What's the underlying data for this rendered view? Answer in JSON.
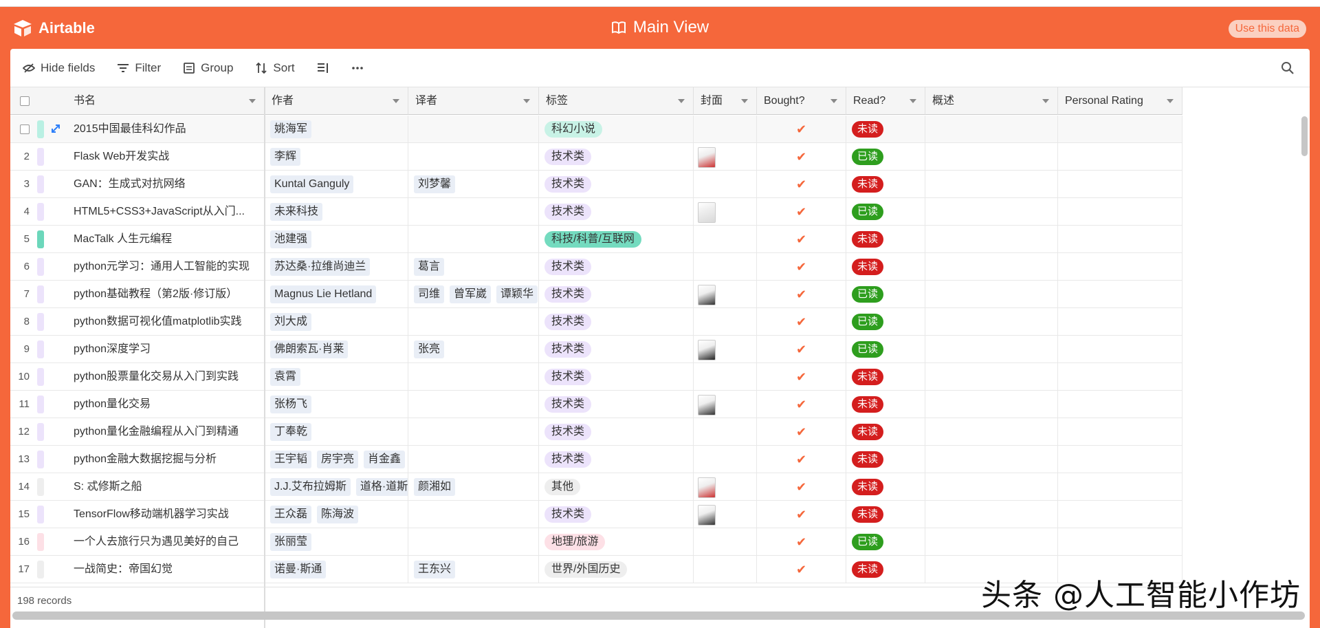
{
  "header": {
    "brand": "Airtable",
    "view_title": "Main View",
    "use_data": "Use this data"
  },
  "toolbar": {
    "hide_fields": "Hide fields",
    "filter": "Filter",
    "group": "Group",
    "sort": "Sort"
  },
  "columns": {
    "title": "书名",
    "author": "作者",
    "translator": "译者",
    "tags": "标签",
    "cover": "封面",
    "bought": "Bought?",
    "read": "Read?",
    "summary": "概述",
    "rating": "Personal Rating"
  },
  "colors": {
    "brand": "#f5673b",
    "read": "#2e9e1e",
    "unread": "#d41e1e"
  },
  "rows": [
    {
      "num": "",
      "bar": "#b9f0e3",
      "title": "2015中国最佳科幻作品",
      "authors": [
        "姚海军"
      ],
      "translators": [],
      "tag": "科幻小说",
      "tag_bg": "#c8f2e6",
      "cover": false,
      "bought": "✔",
      "read": "未读",
      "read_color": "#d41e1e"
    },
    {
      "num": "2",
      "bar": "#ece3fb",
      "title": "Flask Web开发实战",
      "authors": [
        "李辉"
      ],
      "translators": [],
      "tag": "技术类",
      "tag_bg": "#ece3fb",
      "cover": true,
      "bought": "✔",
      "read": "已读",
      "read_color": "#2e9e1e"
    },
    {
      "num": "3",
      "bar": "#ece3fb",
      "title": "GAN：生成式对抗网络",
      "authors": [
        "Kuntal Ganguly"
      ],
      "translators": [
        "刘梦馨"
      ],
      "tag": "技术类",
      "tag_bg": "#ece3fb",
      "cover": false,
      "bought": "✔",
      "read": "未读",
      "read_color": "#d41e1e"
    },
    {
      "num": "4",
      "bar": "#ece3fb",
      "title": "HTML5+CSS3+JavaScript从入门...",
      "authors": [
        "未来科技"
      ],
      "translators": [],
      "tag": "技术类",
      "tag_bg": "#ece3fb",
      "cover": true,
      "bought": "✔",
      "read": "已读",
      "read_color": "#2e9e1e"
    },
    {
      "num": "5",
      "bar": "#6cd7bb",
      "title": "MacTalk 人生元编程",
      "authors": [
        "池建强"
      ],
      "translators": [],
      "tag": "科技/科普/互联网",
      "tag_bg": "#74dbbf",
      "cover": false,
      "bought": "✔",
      "read": "未读",
      "read_color": "#d41e1e"
    },
    {
      "num": "6",
      "bar": "#ece3fb",
      "title": "python元学习：通用人工智能的实现",
      "authors": [
        "苏达桑·拉维尚迪兰"
      ],
      "translators": [
        "葛言"
      ],
      "tag": "技术类",
      "tag_bg": "#ece3fb",
      "cover": false,
      "bought": "✔",
      "read": "未读",
      "read_color": "#d41e1e"
    },
    {
      "num": "7",
      "bar": "#ece3fb",
      "title": "python基础教程（第2版·修订版）",
      "authors": [
        "Magnus Lie Hetland"
      ],
      "translators": [
        "司维",
        "曾军崴",
        "谭颖华"
      ],
      "tag": "技术类",
      "tag_bg": "#ece3fb",
      "cover": true,
      "bought": "✔",
      "read": "已读",
      "read_color": "#2e9e1e"
    },
    {
      "num": "8",
      "bar": "#ece3fb",
      "title": "python数据可视化值matplotlib实践",
      "authors": [
        "刘大成"
      ],
      "translators": [],
      "tag": "技术类",
      "tag_bg": "#ece3fb",
      "cover": false,
      "bought": "✔",
      "read": "已读",
      "read_color": "#2e9e1e"
    },
    {
      "num": "9",
      "bar": "#ece3fb",
      "title": "python深度学习",
      "authors": [
        "佛朗索瓦·肖莱"
      ],
      "translators": [
        "张亮"
      ],
      "tag": "技术类",
      "tag_bg": "#ece3fb",
      "cover": true,
      "bought": "✔",
      "read": "已读",
      "read_color": "#2e9e1e"
    },
    {
      "num": "10",
      "bar": "#ece3fb",
      "title": "python股票量化交易从入门到实践",
      "authors": [
        "袁霄"
      ],
      "translators": [],
      "tag": "技术类",
      "tag_bg": "#ece3fb",
      "cover": false,
      "bought": "✔",
      "read": "未读",
      "read_color": "#d41e1e"
    },
    {
      "num": "11",
      "bar": "#ece3fb",
      "title": "python量化交易",
      "authors": [
        "张杨飞"
      ],
      "translators": [],
      "tag": "技术类",
      "tag_bg": "#ece3fb",
      "cover": true,
      "bought": "✔",
      "read": "未读",
      "read_color": "#d41e1e"
    },
    {
      "num": "12",
      "bar": "#ece3fb",
      "title": "python量化金融编程从入门到精通",
      "authors": [
        "丁奉乾"
      ],
      "translators": [],
      "tag": "技术类",
      "tag_bg": "#ece3fb",
      "cover": false,
      "bought": "✔",
      "read": "未读",
      "read_color": "#d41e1e"
    },
    {
      "num": "13",
      "bar": "#ece3fb",
      "title": "python金融大数据挖掘与分析",
      "authors": [
        "王宇韬",
        "房宇亮",
        "肖金鑫"
      ],
      "translators": [],
      "tag": "技术类",
      "tag_bg": "#ece3fb",
      "cover": false,
      "bought": "✔",
      "read": "未读",
      "read_color": "#d41e1e"
    },
    {
      "num": "14",
      "bar": "#eeeeee",
      "title": "S: 忒修斯之船",
      "authors": [
        "J.J.艾布拉姆斯",
        "道格·道斯特"
      ],
      "translators": [
        "颜湘如"
      ],
      "tag": "其他",
      "tag_bg": "#eeeeee",
      "cover": true,
      "bought": "✔",
      "read": "未读",
      "read_color": "#d41e1e"
    },
    {
      "num": "15",
      "bar": "#ece3fb",
      "title": "TensorFlow移动端机器学习实战",
      "authors": [
        "王众磊",
        "陈海波"
      ],
      "translators": [],
      "tag": "技术类",
      "tag_bg": "#ece3fb",
      "cover": true,
      "bought": "✔",
      "read": "未读",
      "read_color": "#d41e1e"
    },
    {
      "num": "16",
      "bar": "#fde0e6",
      "title": "一个人去旅行只为遇见美好的自己",
      "authors": [
        "张丽莹"
      ],
      "translators": [],
      "tag": "地理/旅游",
      "tag_bg": "#fde0e6",
      "cover": false,
      "bought": "✔",
      "read": "已读",
      "read_color": "#2e9e1e"
    },
    {
      "num": "17",
      "bar": "#eeeeee",
      "title": "一战简史：帝国幻觉",
      "authors": [
        "诺曼·斯通"
      ],
      "translators": [
        "王东兴"
      ],
      "tag": "世界/外国历史",
      "tag_bg": "#eeeeee",
      "cover": false,
      "bought": "✔",
      "read": "未读",
      "read_color": "#d41e1e"
    }
  ],
  "footer": {
    "records": "198 records"
  },
  "watermark": "头条 @人工智能小作坊"
}
